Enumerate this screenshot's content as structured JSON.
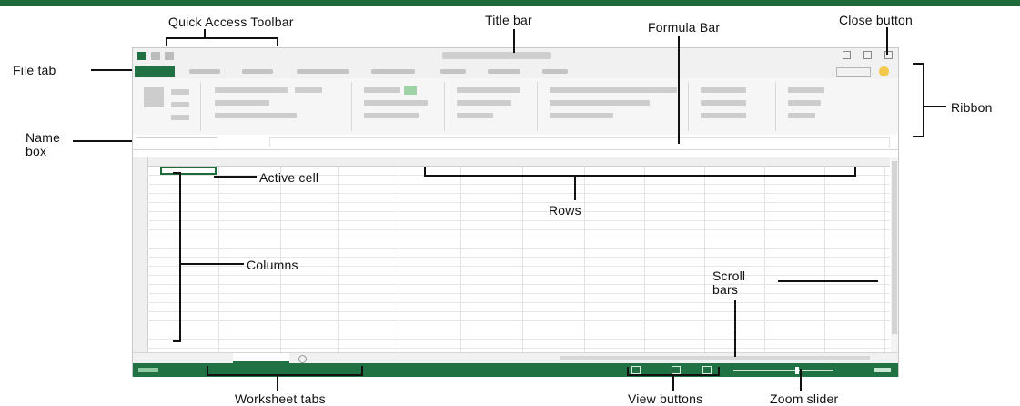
{
  "callouts": {
    "quick_access_toolbar": "Quick Access Toolbar",
    "title_bar": "Title bar",
    "formula_bar": "Formula Bar",
    "close_button": "Close button",
    "file_tab": "File tab",
    "ribbon": "Ribbon",
    "name_box": "Name\nbox",
    "active_cell": "Active cell",
    "rows": "Rows",
    "columns": "Columns",
    "scroll_bars": "Scroll\nbars",
    "worksheet_tabs": "Worksheet tabs",
    "view_buttons": "View buttons",
    "zoom_slider": "Zoom slider"
  },
  "colors": {
    "accent": "#1e6b3a",
    "excel_green": "#207245"
  },
  "icons": [
    "save-icon",
    "undo-icon",
    "redo-icon",
    "minimize-icon",
    "restore-icon",
    "close-icon",
    "smiley-icon",
    "add-sheet-icon"
  ]
}
